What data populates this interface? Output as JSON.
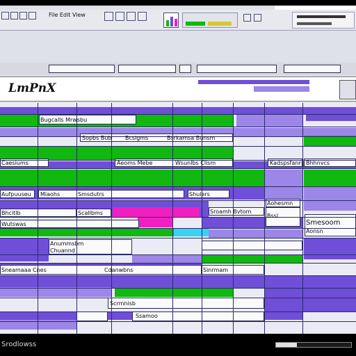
{
  "window": {
    "title": ""
  },
  "toolbar": {
    "menu_label": "File  Edit  View",
    "top_right_label": "",
    "icons": [
      "new-icon",
      "open-icon",
      "save-icon",
      "print-icon",
      "cut-icon",
      "copy-icon",
      "paste-icon",
      "undo-icon",
      "chart-icon",
      "zoom-icon",
      "help-icon"
    ]
  },
  "formula_bar": {
    "name_box": "",
    "fields": [
      "",
      "",
      "",
      "",
      ""
    ]
  },
  "app": {
    "logo_text": "LmPnX"
  },
  "header_cells": [
    "",
    "",
    "",
    ""
  ],
  "grid_labels": [
    "Bugcalls Mrwsbu",
    "Sopbs Bub",
    "Bcsigms",
    "Bsrkamsa Bunsm",
    "Caesiums",
    "Aeoms Mebe",
    "Wsunlbs Cllsm",
    "Kadspsfanmb",
    "Aufpuuseu",
    "Miaohs",
    "Smsdutrs",
    "Shulers",
    "Bhcitlb",
    "Scallbms",
    "Sroamh Bvtom",
    "Wutswas",
    "Aohesmn",
    "Anummsbm",
    "Chuannd",
    "Sneamaaa Cnes",
    "Cdanwbns",
    "Sinrmam",
    "Scrmnisb",
    "Ssamoo"
  ],
  "right_panel": {
    "labels": [
      "Bhhnvcs",
      "Smesoom",
      "Aonsn",
      "Bssl"
    ]
  },
  "status_bar": {
    "text": "Srodlowss",
    "progress": 0.28
  },
  "colors": {
    "green": "#10b810",
    "purple": "#6f4ed8",
    "light_purple": "#9c86e8",
    "magenta": "#f020c0",
    "cyan": "#36d4f2",
    "navy": "#2b2a6a"
  }
}
